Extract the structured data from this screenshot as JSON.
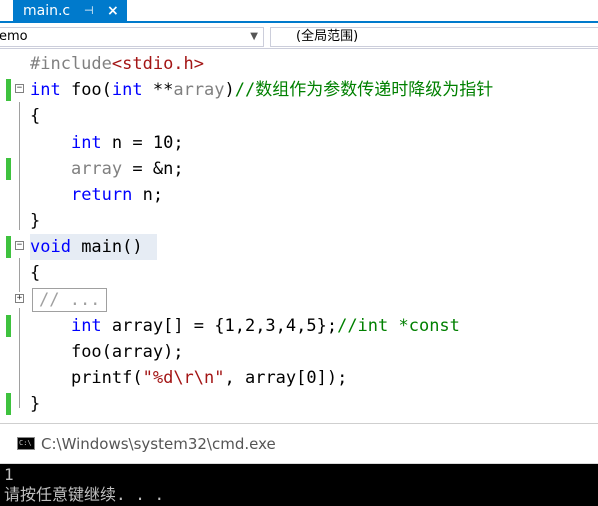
{
  "tab": {
    "filename": "main.c",
    "pin_glyph": "⊣",
    "close_glyph": "×"
  },
  "navbar": {
    "project": "emo",
    "scope": "(全局范围)"
  },
  "code": {
    "l1_pp": "#include",
    "l1_hdr": "<stdio.h>",
    "l2_kw1": "int",
    "l2_fn": " foo(",
    "l2_kw2": "int",
    "l2_ptr": " **",
    "l2_param": "array",
    "l2_close": ")",
    "l2_comment": "//数组作为参数传递时降级为指针",
    "l3": "{",
    "l4_kw": "int",
    "l4_rest": " n = 10;",
    "l5_param": "array",
    "l5_rest": " = &n;",
    "l6_kw": "return",
    "l6_rest": " n;",
    "l7": "}",
    "l8_kw": "void",
    "l8_rest": " main()",
    "l9": "{",
    "l10_collapsed": "// ...",
    "l11_kw": "int",
    "l11_rest": " array[] = {1,2,3,4,5};",
    "l11_comment": "//int *const",
    "l12": "foo(array);",
    "l13_fn": "printf(",
    "l13_str": "\"%d\\r\\n\"",
    "l13_rest": ", array[0]);",
    "l14": "}"
  },
  "console": {
    "title": "C:\\Windows\\system32\\cmd.exe",
    "icon_text": "C:\\",
    "output_line1": "1",
    "output_line2": "请按任意键继续. . ."
  },
  "colors": {
    "tab_accent": "#007acc",
    "keyword": "#0000ff",
    "comment": "#008000",
    "change_bar": "#3ec23e"
  }
}
